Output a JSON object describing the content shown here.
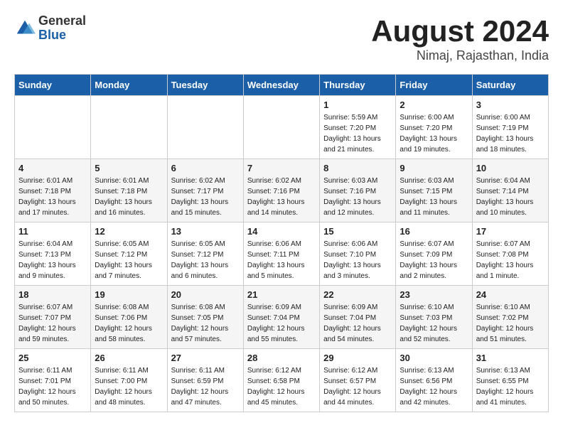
{
  "header": {
    "logo_general": "General",
    "logo_blue": "Blue",
    "month_title": "August 2024",
    "subtitle": "Nimaj, Rajasthan, India"
  },
  "weekdays": [
    "Sunday",
    "Monday",
    "Tuesday",
    "Wednesday",
    "Thursday",
    "Friday",
    "Saturday"
  ],
  "weeks": [
    [
      {
        "day": "",
        "info": ""
      },
      {
        "day": "",
        "info": ""
      },
      {
        "day": "",
        "info": ""
      },
      {
        "day": "",
        "info": ""
      },
      {
        "day": "1",
        "info": "Sunrise: 5:59 AM\nSunset: 7:20 PM\nDaylight: 13 hours\nand 21 minutes."
      },
      {
        "day": "2",
        "info": "Sunrise: 6:00 AM\nSunset: 7:20 PM\nDaylight: 13 hours\nand 19 minutes."
      },
      {
        "day": "3",
        "info": "Sunrise: 6:00 AM\nSunset: 7:19 PM\nDaylight: 13 hours\nand 18 minutes."
      }
    ],
    [
      {
        "day": "4",
        "info": "Sunrise: 6:01 AM\nSunset: 7:18 PM\nDaylight: 13 hours\nand 17 minutes."
      },
      {
        "day": "5",
        "info": "Sunrise: 6:01 AM\nSunset: 7:18 PM\nDaylight: 13 hours\nand 16 minutes."
      },
      {
        "day": "6",
        "info": "Sunrise: 6:02 AM\nSunset: 7:17 PM\nDaylight: 13 hours\nand 15 minutes."
      },
      {
        "day": "7",
        "info": "Sunrise: 6:02 AM\nSunset: 7:16 PM\nDaylight: 13 hours\nand 14 minutes."
      },
      {
        "day": "8",
        "info": "Sunrise: 6:03 AM\nSunset: 7:16 PM\nDaylight: 13 hours\nand 12 minutes."
      },
      {
        "day": "9",
        "info": "Sunrise: 6:03 AM\nSunset: 7:15 PM\nDaylight: 13 hours\nand 11 minutes."
      },
      {
        "day": "10",
        "info": "Sunrise: 6:04 AM\nSunset: 7:14 PM\nDaylight: 13 hours\nand 10 minutes."
      }
    ],
    [
      {
        "day": "11",
        "info": "Sunrise: 6:04 AM\nSunset: 7:13 PM\nDaylight: 13 hours\nand 9 minutes."
      },
      {
        "day": "12",
        "info": "Sunrise: 6:05 AM\nSunset: 7:12 PM\nDaylight: 13 hours\nand 7 minutes."
      },
      {
        "day": "13",
        "info": "Sunrise: 6:05 AM\nSunset: 7:12 PM\nDaylight: 13 hours\nand 6 minutes."
      },
      {
        "day": "14",
        "info": "Sunrise: 6:06 AM\nSunset: 7:11 PM\nDaylight: 13 hours\nand 5 minutes."
      },
      {
        "day": "15",
        "info": "Sunrise: 6:06 AM\nSunset: 7:10 PM\nDaylight: 13 hours\nand 3 minutes."
      },
      {
        "day": "16",
        "info": "Sunrise: 6:07 AM\nSunset: 7:09 PM\nDaylight: 13 hours\nand 2 minutes."
      },
      {
        "day": "17",
        "info": "Sunrise: 6:07 AM\nSunset: 7:08 PM\nDaylight: 13 hours\nand 1 minute."
      }
    ],
    [
      {
        "day": "18",
        "info": "Sunrise: 6:07 AM\nSunset: 7:07 PM\nDaylight: 12 hours\nand 59 minutes."
      },
      {
        "day": "19",
        "info": "Sunrise: 6:08 AM\nSunset: 7:06 PM\nDaylight: 12 hours\nand 58 minutes."
      },
      {
        "day": "20",
        "info": "Sunrise: 6:08 AM\nSunset: 7:05 PM\nDaylight: 12 hours\nand 57 minutes."
      },
      {
        "day": "21",
        "info": "Sunrise: 6:09 AM\nSunset: 7:04 PM\nDaylight: 12 hours\nand 55 minutes."
      },
      {
        "day": "22",
        "info": "Sunrise: 6:09 AM\nSunset: 7:04 PM\nDaylight: 12 hours\nand 54 minutes."
      },
      {
        "day": "23",
        "info": "Sunrise: 6:10 AM\nSunset: 7:03 PM\nDaylight: 12 hours\nand 52 minutes."
      },
      {
        "day": "24",
        "info": "Sunrise: 6:10 AM\nSunset: 7:02 PM\nDaylight: 12 hours\nand 51 minutes."
      }
    ],
    [
      {
        "day": "25",
        "info": "Sunrise: 6:11 AM\nSunset: 7:01 PM\nDaylight: 12 hours\nand 50 minutes."
      },
      {
        "day": "26",
        "info": "Sunrise: 6:11 AM\nSunset: 7:00 PM\nDaylight: 12 hours\nand 48 minutes."
      },
      {
        "day": "27",
        "info": "Sunrise: 6:11 AM\nSunset: 6:59 PM\nDaylight: 12 hours\nand 47 minutes."
      },
      {
        "day": "28",
        "info": "Sunrise: 6:12 AM\nSunset: 6:58 PM\nDaylight: 12 hours\nand 45 minutes."
      },
      {
        "day": "29",
        "info": "Sunrise: 6:12 AM\nSunset: 6:57 PM\nDaylight: 12 hours\nand 44 minutes."
      },
      {
        "day": "30",
        "info": "Sunrise: 6:13 AM\nSunset: 6:56 PM\nDaylight: 12 hours\nand 42 minutes."
      },
      {
        "day": "31",
        "info": "Sunrise: 6:13 AM\nSunset: 6:55 PM\nDaylight: 12 hours\nand 41 minutes."
      }
    ]
  ]
}
